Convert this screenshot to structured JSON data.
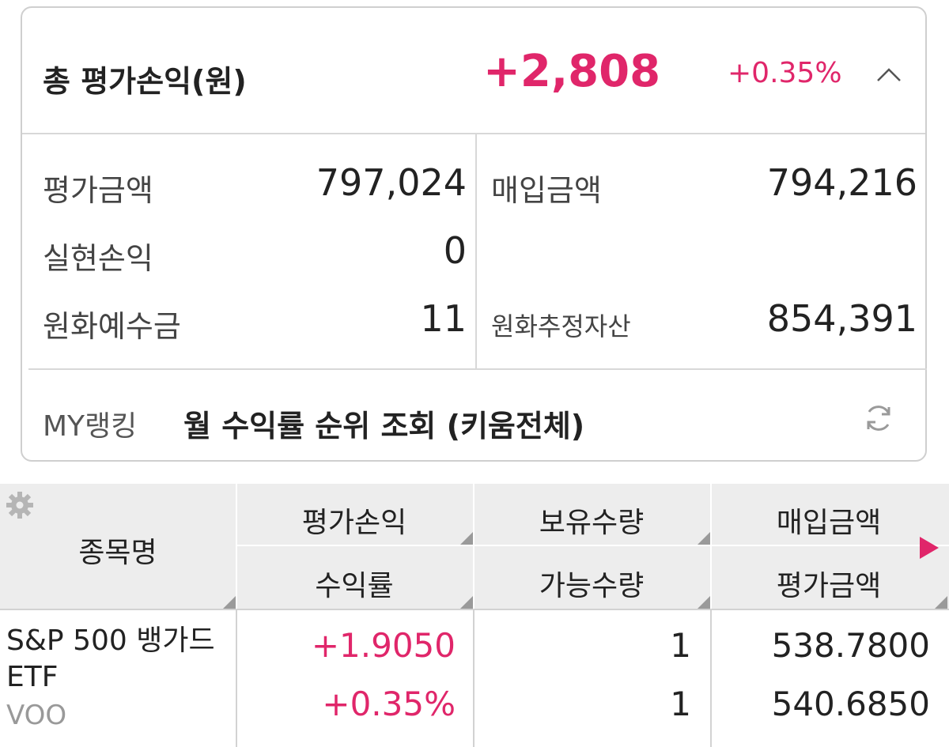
{
  "summary": {
    "title": "총 평가손익(원)",
    "total_pnl": "+2,808",
    "total_rate": "+0.35%",
    "accent_color": "#e0266a",
    "collapse_icon": "chevron-up-icon",
    "items": {
      "eval_amount": {
        "label": "평가금액",
        "value": "797,024"
      },
      "purchase_amount": {
        "label": "매입금액",
        "value": "794,216"
      },
      "realized_pnl": {
        "label": "실현손익",
        "value": "0"
      },
      "krw_deposit": {
        "label": "원화예수금",
        "value": "11"
      },
      "krw_est_assets": {
        "label": "원화추정자산",
        "value": "854,391"
      }
    },
    "ranking": {
      "label": "MY랭킹",
      "text": "월 수익률 순위 조회 (키움전체)",
      "icon": "refresh-icon"
    }
  },
  "table": {
    "settings_icon": "gear-icon",
    "headers": {
      "name": "종목명",
      "pnl": "평가손익",
      "rate": "수익률",
      "holding_qty": "보유수량",
      "available_qty": "가능수량",
      "purchase_amount": "매입금액",
      "eval_amount": "평가금액"
    },
    "rows": [
      {
        "name": "S&P 500 뱅가드 ETF",
        "code": "VOO",
        "pnl": "+1.9050",
        "rate": "+0.35%",
        "holding_qty": "1",
        "available_qty": "1",
        "purchase_amount": "538.7800",
        "eval_amount": "540.6850"
      }
    ]
  }
}
